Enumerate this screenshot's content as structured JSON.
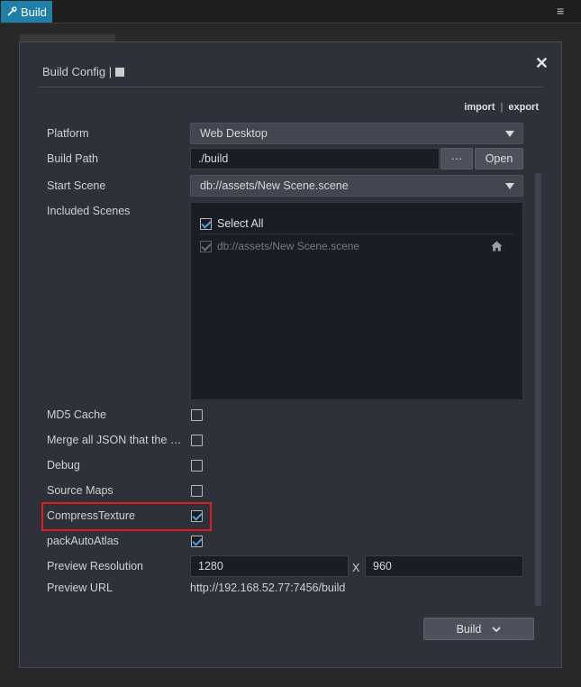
{
  "window": {
    "tab_label": "Build",
    "menu_glyph": "≡"
  },
  "dialog": {
    "title": "Build Config |",
    "close_glyph": "✕",
    "import_label": "import",
    "export_label": "export",
    "separator": "|"
  },
  "form": {
    "platform": {
      "label": "Platform",
      "value": "Web Desktop"
    },
    "build_path": {
      "label": "Build Path",
      "value": "./build",
      "browse_label": "···",
      "open_label": "Open"
    },
    "start_scene": {
      "label": "Start Scene",
      "value": "db://assets/New Scene.scene"
    },
    "included_scenes": {
      "label": "Included Scenes",
      "select_all_label": "Select All",
      "select_all_checked": true,
      "scenes": [
        {
          "path": "db://assets/New Scene.scene",
          "checked": true
        }
      ]
    },
    "md5_cache": {
      "label": "MD5 Cache",
      "checked": false
    },
    "merge_json": {
      "label": "Merge all JSON that the S...",
      "checked": false
    },
    "debug": {
      "label": "Debug",
      "checked": false
    },
    "source_maps": {
      "label": "Source Maps",
      "checked": false
    },
    "compress_texture": {
      "label": "CompressTexture",
      "checked": true
    },
    "pack_auto_atlas": {
      "label": "packAutoAtlas",
      "checked": true
    },
    "preview_resolution": {
      "label": "Preview Resolution",
      "width": "1280",
      "separator": "X",
      "height": "960"
    },
    "preview_url": {
      "label": "Preview URL",
      "value": "http://192.168.52.77:7456/build"
    }
  },
  "footer": {
    "build_label": "Build"
  },
  "colors": {
    "tab_active": "#1e7fa8",
    "dialog_bg": "#2e313a",
    "checkmark": "#4aa3df",
    "highlight": "#e01e1e"
  }
}
